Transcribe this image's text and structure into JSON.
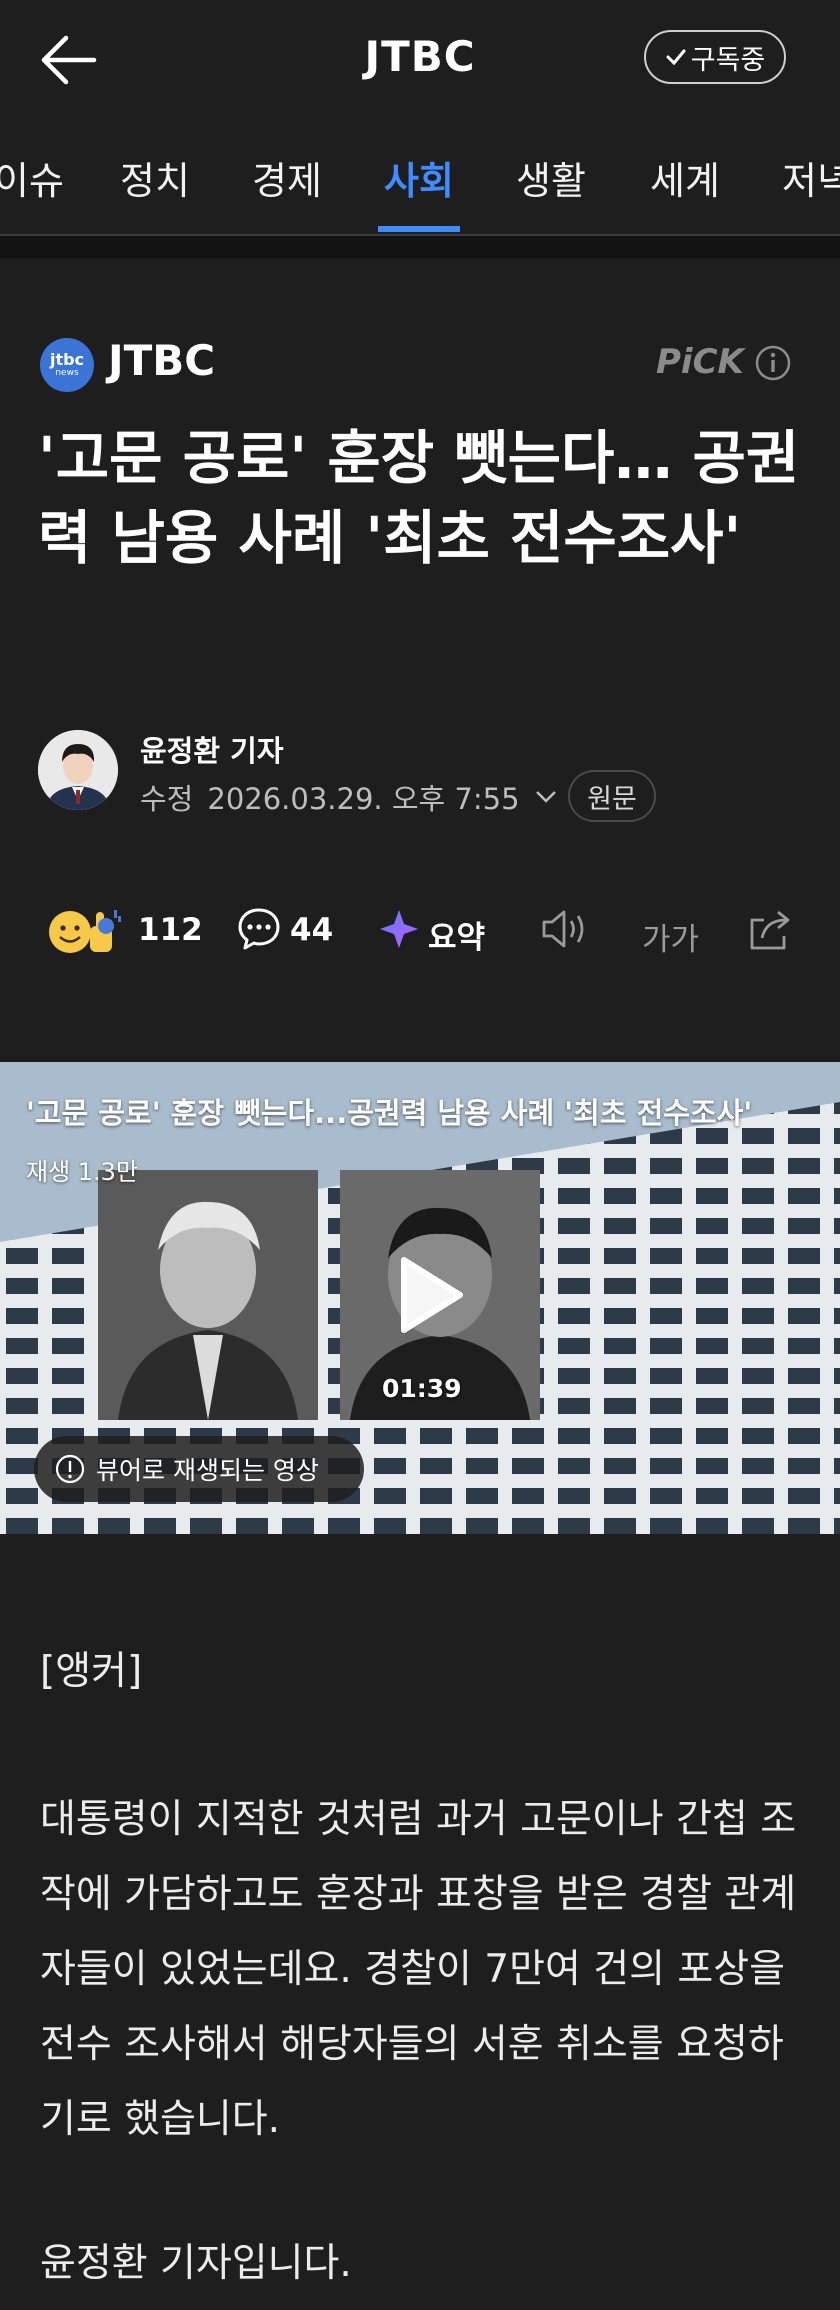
{
  "header": {
    "title": "JTBC",
    "subscribe_label": "구독중"
  },
  "tabs": [
    "이슈",
    "정치",
    "경제",
    "사회",
    "생활",
    "세계",
    "저녁"
  ],
  "active_tab": "사회",
  "press": {
    "logo_line1": "jtbc",
    "logo_line2": "news",
    "name": "JTBC",
    "pick_label": "PiCK"
  },
  "article": {
    "headline": "'고문 공로' 훈장 뺏는다… 공권력 남용 사례 '최초 전수조사'",
    "author": "윤정환 기자",
    "edit_label": "수정",
    "timestamp": "2026.03.29. 오후 7:55",
    "original_label": "원문"
  },
  "actions": {
    "reactions_count": "112",
    "comments_count": "44",
    "summary_label": "요약",
    "font_label": "가가"
  },
  "video": {
    "title": "'고문 공로' 훈장 뺏는다...공권력 남용 사례 '최초 전수조사'",
    "views": "재생 1.3만",
    "duration": "01:39",
    "viewer_notice": "뷰어로 재생되는 영상"
  },
  "body": {
    "anchor_tag": "[앵커]",
    "paragraph1": "대통령이 지적한 것처럼 과거 고문이나 간첩 조작에 가담하고도 훈장과 표창을 받은 경찰 관계자들이 있었는데요. 경찰이 7만여 건의 포상을 전수 조사해서 해당자들의 서훈 취소를 요청하기로 했습니다.",
    "paragraph2": "윤정환 기자입니다."
  },
  "colors": {
    "background": "#1e1e1f",
    "accent": "#3f8cff",
    "press_logo": "#3b73d6"
  },
  "icons": [
    "back-arrow-icon",
    "check-icon",
    "info-icon",
    "emoji-reaction-icon",
    "comment-icon",
    "ai-summary-icon",
    "speaker-icon",
    "share-icon",
    "chevron-down-icon",
    "play-icon",
    "alert-icon"
  ]
}
